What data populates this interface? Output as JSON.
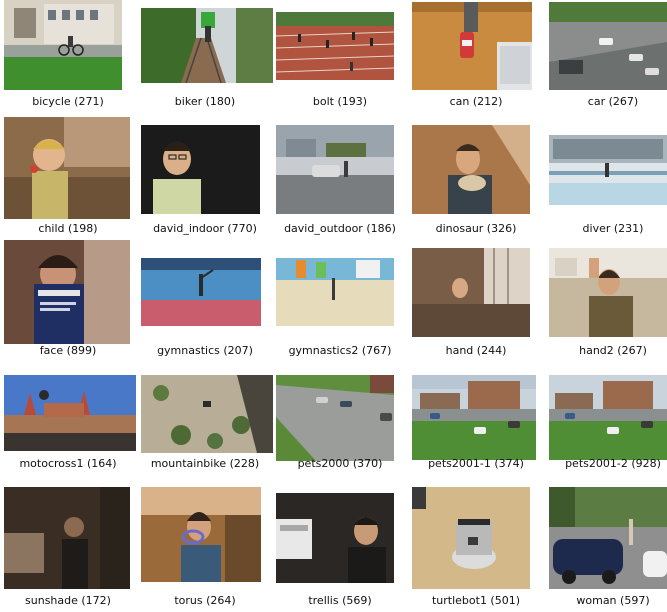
{
  "gallery": {
    "items": [
      {
        "name": "bicycle",
        "count": "271",
        "label": "bicycle (271)"
      },
      {
        "name": "biker",
        "count": "180",
        "label": "biker (180)"
      },
      {
        "name": "bolt",
        "count": "193",
        "label": "bolt (193)"
      },
      {
        "name": "can",
        "count": "212",
        "label": "can (212)"
      },
      {
        "name": "car",
        "count": "267",
        "label": "car (267)"
      },
      {
        "name": "child",
        "count": "198",
        "label": "child (198)"
      },
      {
        "name": "david_indoor",
        "count": "770",
        "label": "david_indoor (770)"
      },
      {
        "name": "david_outdoor",
        "count": "186",
        "label": "david_outdoor (186)"
      },
      {
        "name": "dinosaur",
        "count": "326",
        "label": "dinosaur (326)"
      },
      {
        "name": "diver",
        "count": "231",
        "label": "diver (231)"
      },
      {
        "name": "face",
        "count": "899",
        "label": "face (899)"
      },
      {
        "name": "gymnastics",
        "count": "207",
        "label": "gymnastics (207)"
      },
      {
        "name": "gymnastics2",
        "count": "767",
        "label": "gymnastics2 (767)"
      },
      {
        "name": "hand",
        "count": "244",
        "label": "hand (244)"
      },
      {
        "name": "hand2",
        "count": "267",
        "label": "hand2 (267)"
      },
      {
        "name": "motocross1",
        "count": "164",
        "label": "motocross1 (164)"
      },
      {
        "name": "mountainbike",
        "count": "228",
        "label": "mountainbike (228)"
      },
      {
        "name": "pets2000",
        "count": "370",
        "label": "pets2000 (370)"
      },
      {
        "name": "pets2001-1",
        "count": "374",
        "label": "pets2001-1 (374)"
      },
      {
        "name": "pets2001-2",
        "count": "928",
        "label": "pets2001-2 (928)"
      },
      {
        "name": "sunshade",
        "count": "172",
        "label": "sunshade (172)"
      },
      {
        "name": "torus",
        "count": "264",
        "label": "torus (264)"
      },
      {
        "name": "trellis",
        "count": "569",
        "label": "trellis (569)"
      },
      {
        "name": "turtlebot1",
        "count": "501",
        "label": "turtlebot1 (501)"
      },
      {
        "name": "woman",
        "count": "597",
        "label": "woman (597)"
      }
    ]
  }
}
